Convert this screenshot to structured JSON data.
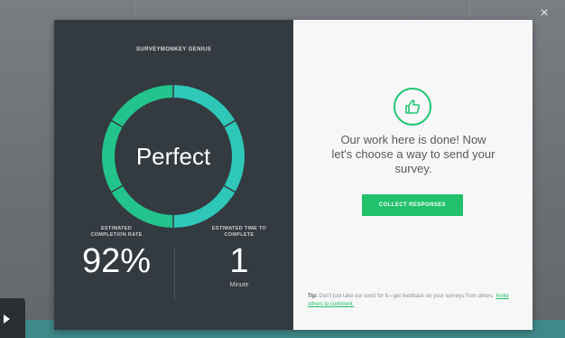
{
  "modal": {
    "close_label": "×",
    "left": {
      "title": "SURVEYMONKEY GENIUS",
      "ring_label": "Perfect",
      "ring_color": "#23c48c",
      "ring_color_2": "#2ec7b8",
      "ring_track_color": "#2a3036",
      "stats": [
        {
          "caption_line1": "ESTIMATED",
          "caption_line2": "COMPLETION RATE",
          "value": "92%",
          "unit": ""
        },
        {
          "caption_line1": "ESTIMATED TIME TO",
          "caption_line2": "COMPLETE",
          "value": "1",
          "unit": "Minute"
        }
      ]
    },
    "right": {
      "done_line1": "Our work here is done! Now",
      "done_line2": "let's choose a way to send your",
      "done_line3": "survey.",
      "cta_label": "COLLECT RESPONSES",
      "accent_color": "#21c16b",
      "tip_lead": "Tip:",
      "tip_body": " Don't just take our word for it—get feedback on your surveys from others. ",
      "tip_link": "Invite others to comment."
    }
  }
}
